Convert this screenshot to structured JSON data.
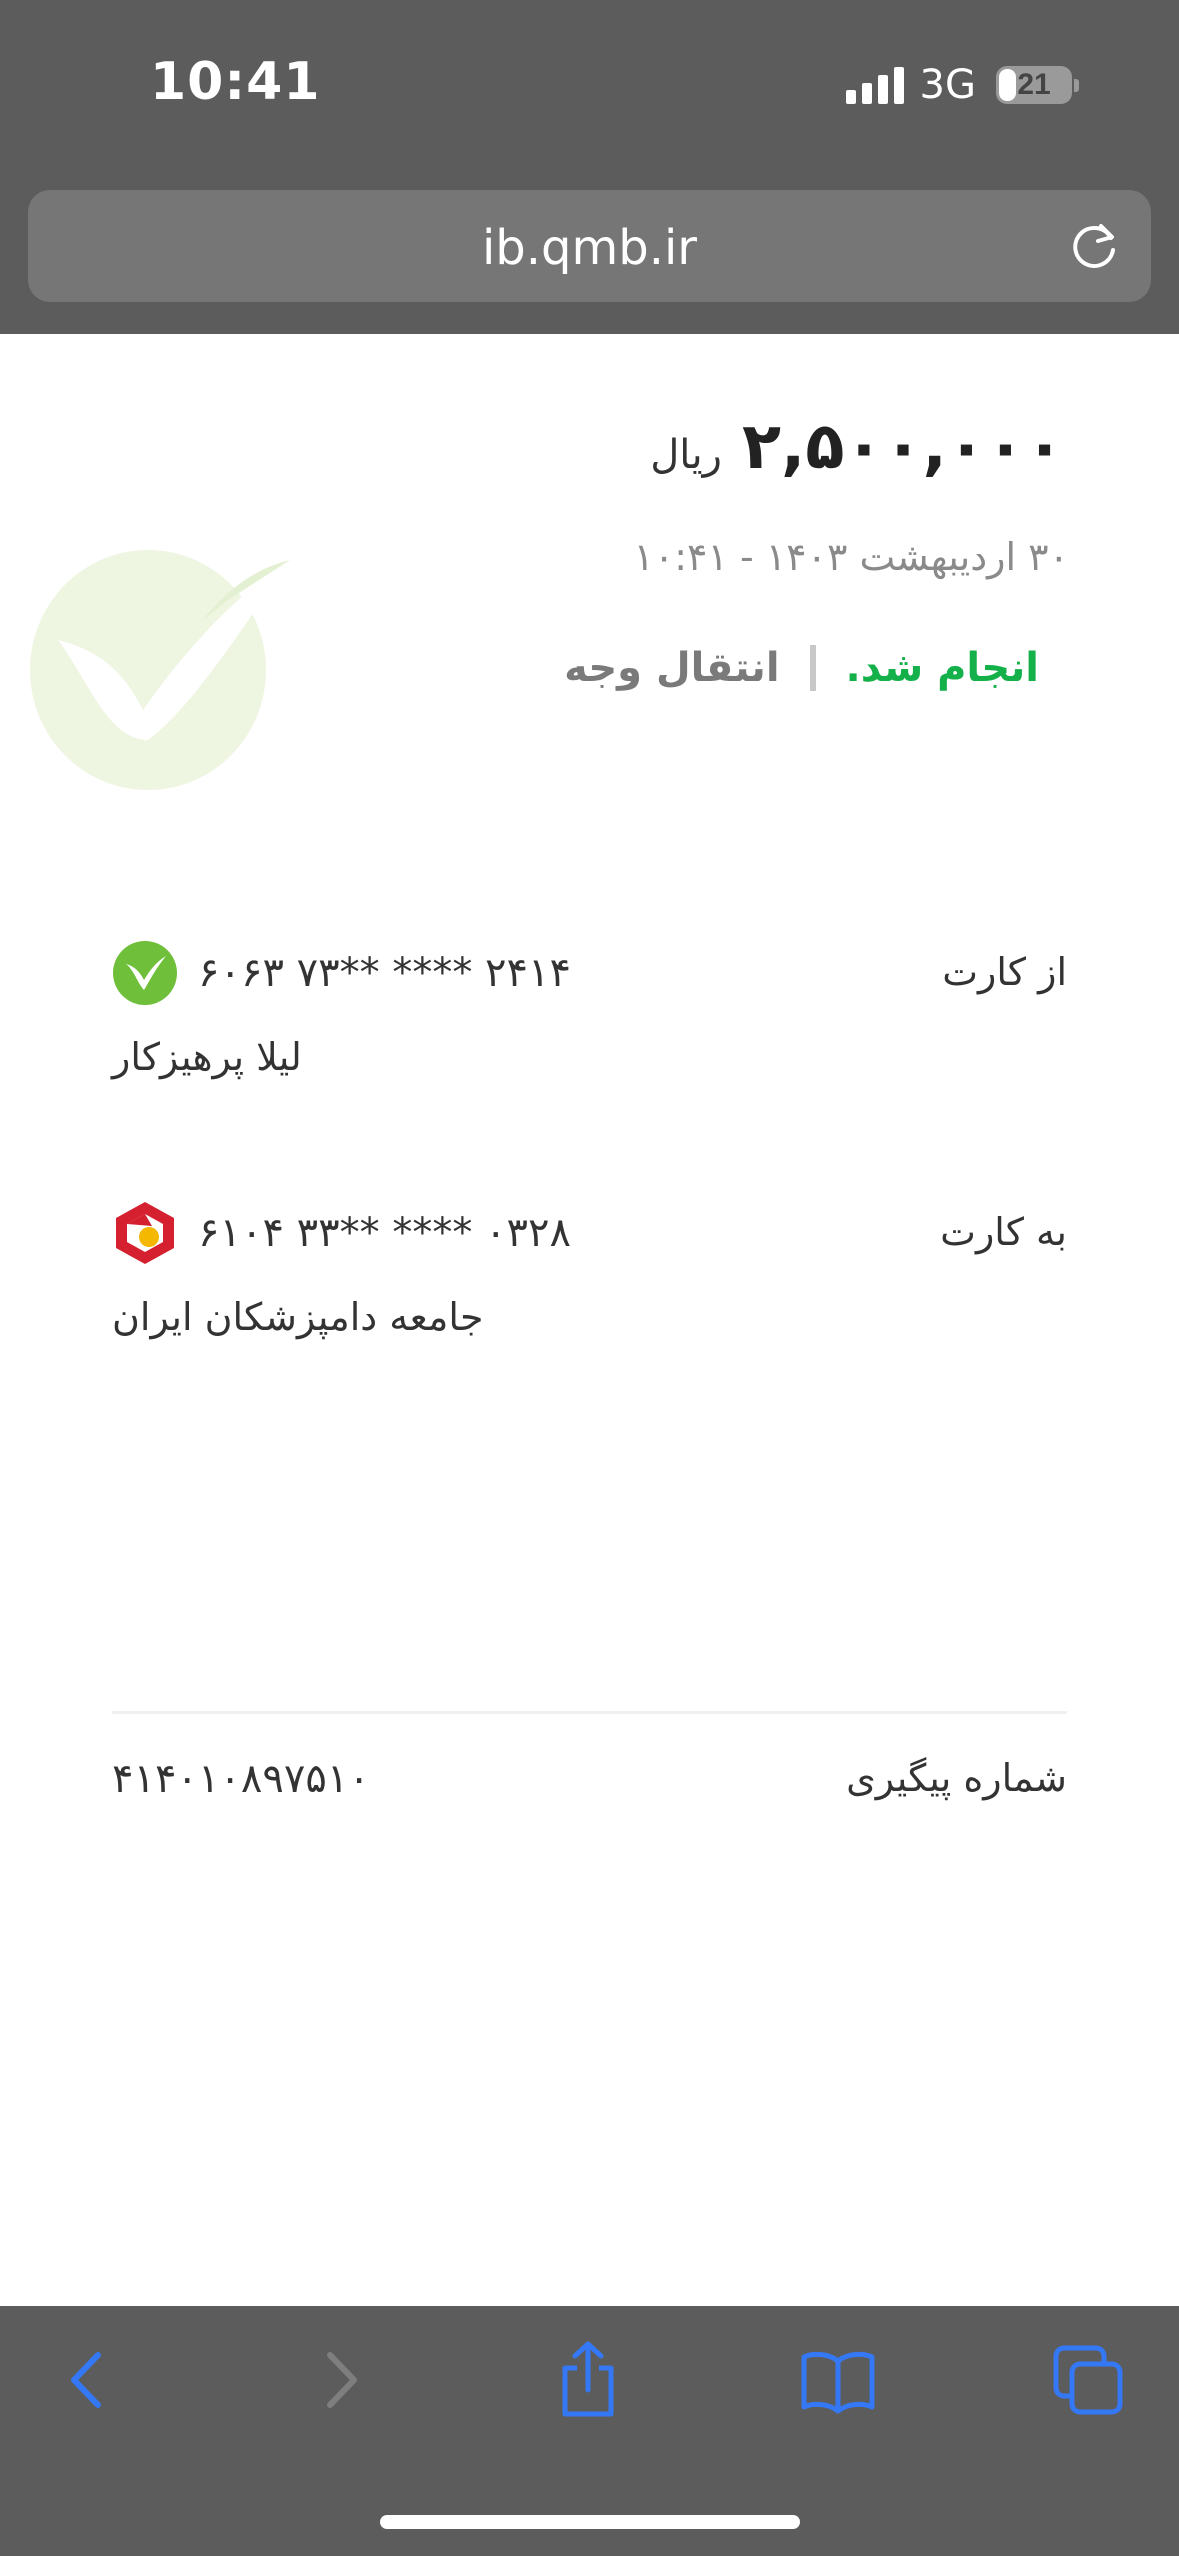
{
  "status_bar": {
    "time": "10:41",
    "network": "3G",
    "battery_level": "21"
  },
  "browser": {
    "url": "ib.qmb.ir",
    "reload_icon": "reload-icon"
  },
  "receipt": {
    "amount": "۲,۵۰۰,۰۰۰",
    "currency": "ریال",
    "datetime": "۳۰ اردیبهشت ۱۴۰۳ - ۱۰:۴۱",
    "status": "انجام شد.",
    "transaction_type": "انتقال وجه",
    "from": {
      "label": "از کارت",
      "card_number": "۶۰۶۳ ۷۳** **** ۲۴۱۴",
      "holder": "لیلا پرهیزکار",
      "bank_icon": "qmb-bank-logo-icon"
    },
    "to": {
      "label": "به کارت",
      "card_number": "۶۱۰۴ ۳۳** **** ۰۳۲۸",
      "holder": "جامعه دامپزشکان ایران",
      "bank_icon": "mellat-bank-logo-icon"
    },
    "tracking": {
      "label": "شماره پیگیری",
      "value": "۴۱۴۰۱۰۸۹۷۵۱۰"
    }
  },
  "toolbar": {
    "icons": [
      "back-icon",
      "forward-icon",
      "share-icon",
      "bookmarks-icon",
      "tabs-icon"
    ]
  },
  "colors": {
    "success": "#14b04a",
    "accent": "#3478f6",
    "chrome": "#5c5c5c"
  }
}
